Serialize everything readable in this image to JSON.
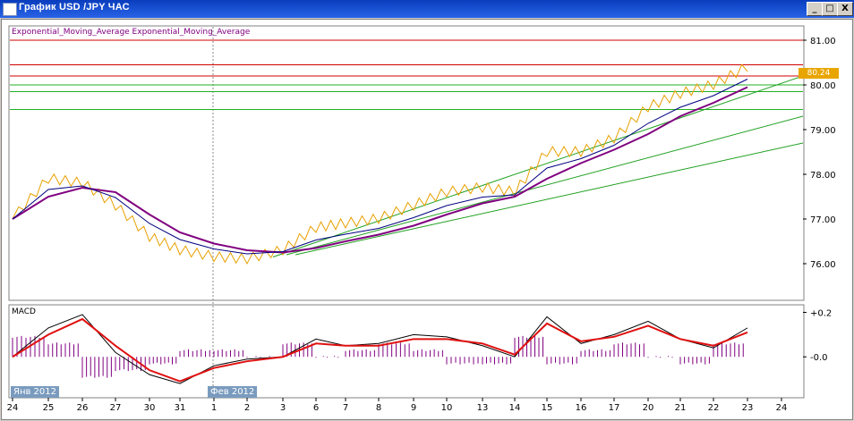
{
  "window": {
    "title": "График USD /JPY  ЧАС",
    "minimize_symbol": "_",
    "maximize_symbol": "□",
    "close_symbol": "X"
  },
  "price_panel": {
    "indicator_legend": "Exponential_Moving_Average Exponential_Moving_Average",
    "current_price": "80.24",
    "y_ticks": [
      "81.00",
      "80.00",
      "79.00",
      "78.00",
      "77.00",
      "76.00"
    ]
  },
  "macd_panel": {
    "label": "MACD",
    "y_ticks": [
      "+0.2",
      "-0.0"
    ]
  },
  "time_axis": {
    "month_labels": [
      "Янв 2012",
      "Фев 2012"
    ],
    "day_labels": [
      "24",
      "25",
      "26",
      "27",
      "30",
      "31",
      "1",
      "2",
      "3",
      "6",
      "7",
      "8",
      "9",
      "10",
      "13",
      "14",
      "15",
      "16",
      "17",
      "20",
      "21",
      "22",
      "23",
      "24"
    ]
  },
  "colors": {
    "price": "#e8a000",
    "ema_fast": "#000080",
    "ema_slow": "#800080",
    "horizontal_red": "#d00000",
    "horizontal_green": "#20b020",
    "trend_green": "#20a020",
    "macd_signal": "#e01010",
    "macd_histogram": "#800080",
    "title_bar": "#0a3dbd"
  },
  "chart_data": [
    {
      "type": "line",
      "series_role": "USD/JPY hourly price",
      "x": [
        "24",
        "25",
        "26",
        "27",
        "30",
        "31",
        "1",
        "2",
        "3",
        "6",
        "7",
        "8",
        "9",
        "10",
        "13",
        "14",
        "15",
        "16",
        "17",
        "20",
        "21",
        "22",
        "23"
      ],
      "series": [
        {
          "values": [
            77.0,
            77.9,
            77.8,
            77.3,
            76.6,
            76.3,
            76.15,
            76.1,
            76.3,
            76.8,
            76.9,
            77.0,
            77.3,
            77.6,
            77.7,
            77.6,
            78.5,
            78.5,
            78.8,
            79.5,
            79.8,
            80.0,
            80.4
          ]
        },
        {
          "values": [
            77.0,
            77.5,
            77.7,
            77.6,
            77.1,
            76.7,
            76.45,
            76.3,
            76.25,
            76.35,
            76.5,
            76.65,
            76.85,
            77.1,
            77.35,
            77.5,
            77.9,
            78.25,
            78.55,
            78.9,
            79.3,
            79.6,
            79.95
          ]
        }
      ],
      "horizontal_levels": [
        81.0,
        80.45,
        80.2,
        80.0,
        79.85,
        79.45
      ],
      "ylim": [
        75.2,
        81.3
      ]
    },
    {
      "type": "line",
      "title": "MACD",
      "x": [
        "24",
        "25",
        "26",
        "27",
        "30",
        "31",
        "1",
        "2",
        "3",
        "6",
        "7",
        "8",
        "9",
        "10",
        "13",
        "14",
        "15",
        "16",
        "17",
        "20",
        "21",
        "22",
        "23"
      ],
      "series": [
        {
          "values": [
            0.0,
            0.13,
            0.19,
            0.02,
            -0.08,
            -0.12,
            -0.04,
            -0.01,
            0.0,
            0.08,
            0.05,
            0.06,
            0.1,
            0.09,
            0.05,
            0.0,
            0.18,
            0.06,
            0.1,
            0.16,
            0.08,
            0.04,
            0.13
          ]
        },
        {
          "values": [
            0.0,
            0.1,
            0.17,
            0.05,
            -0.06,
            -0.11,
            -0.05,
            -0.02,
            0.0,
            0.06,
            0.05,
            0.05,
            0.08,
            0.08,
            0.06,
            0.01,
            0.15,
            0.07,
            0.09,
            0.14,
            0.08,
            0.05,
            0.11
          ]
        }
      ],
      "ylim": [
        -0.18,
        0.23
      ]
    }
  ]
}
